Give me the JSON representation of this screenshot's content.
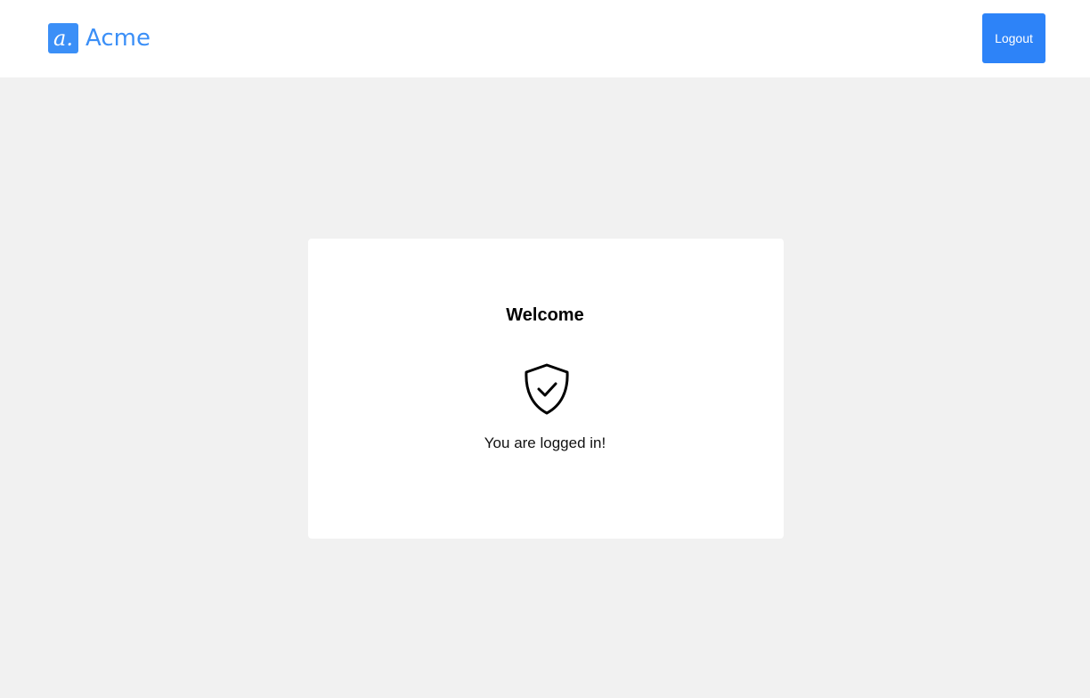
{
  "header": {
    "logo": {
      "mark": "a.",
      "name": "Acme",
      "color": "#3b8ff7"
    },
    "logout_label": "Logout",
    "logout_color": "#2d83f8"
  },
  "card": {
    "title": "Welcome",
    "icon": "shield-check-icon",
    "message": "You are logged in!"
  }
}
